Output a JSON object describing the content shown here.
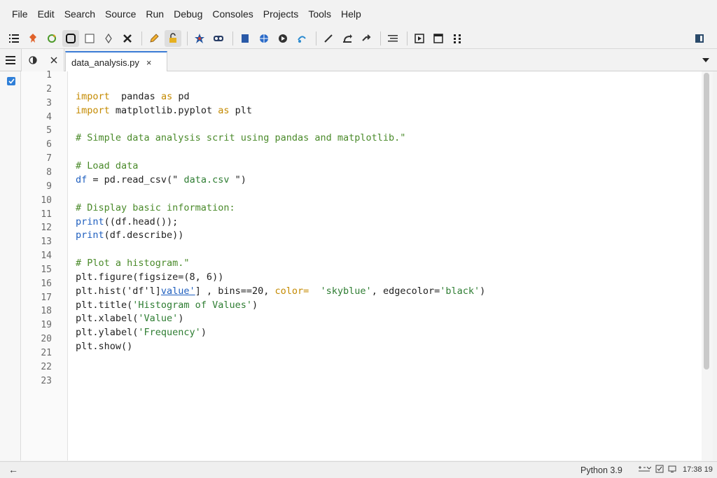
{
  "menu": [
    "File",
    "Edit",
    "Search",
    "Source",
    "Run",
    "Debug",
    "Consoles",
    "Projects",
    "Tools",
    "Help"
  ],
  "toolbar": {
    "icons": [
      "list-icon",
      "pin-icon",
      "refresh-icon",
      "save-icon",
      "square-icon",
      "pointer-icon",
      "debug-icon",
      "edit-icon",
      "unlock-icon",
      "star-icon",
      "bug-icon",
      "save-all-icon",
      "globe-icon",
      "run-icon",
      "step-icon",
      "line-icon",
      "return-icon",
      "jump-icon",
      "indent-icon",
      "maximize-icon",
      "window-icon",
      "grid-icon"
    ],
    "right_icon": "panel-icon"
  },
  "tabs": {
    "active_file": "data_analysis.py",
    "close_glyph": "×"
  },
  "editor": {
    "line_numbers": [
      "1",
      "2",
      "3",
      "4",
      "5",
      "6",
      "7",
      "8",
      "9",
      "10",
      "11",
      "12",
      "13",
      "14",
      "15",
      "16",
      "17",
      "18",
      "19",
      "20",
      "21",
      "22",
      "23"
    ],
    "lines": [
      {
        "n": "2",
        "parts": [
          [
            "kw",
            "import"
          ],
          [
            "",
            "  pandas "
          ],
          [
            "kw",
            "as"
          ],
          [
            "",
            " pd"
          ]
        ]
      },
      {
        "n": "3",
        "parts": [
          [
            "kw",
            "import"
          ],
          [
            "",
            " matplotlib.pyplot "
          ],
          [
            "kw",
            "as"
          ],
          [
            "",
            " plt"
          ]
        ]
      },
      {
        "n": "5",
        "parts": [
          [
            "cm",
            "# Simple data analysis scrit using pandas and matplotlib.\""
          ]
        ]
      },
      {
        "n": "7",
        "parts": [
          [
            "cm",
            "# Load data"
          ]
        ]
      },
      {
        "n": "8",
        "parts": [
          [
            "fn",
            "df"
          ],
          [
            "",
            " = pd.read_csv(\""
          ],
          [
            "st",
            " data.csv "
          ],
          [
            "",
            "\")"
          ]
        ]
      },
      {
        "n": "10",
        "parts": [
          [
            "cm",
            "# Display basic information:"
          ]
        ]
      },
      {
        "n": "11",
        "parts": [
          [
            "fn",
            "print"
          ],
          [
            "",
            "((df.head());"
          ]
        ]
      },
      {
        "n": "12",
        "parts": [
          [
            "fn",
            "print"
          ],
          [
            "",
            "(df.describe))"
          ]
        ]
      },
      {
        "n": "14",
        "parts": [
          [
            "cm",
            "# Plot a histogram.\""
          ]
        ]
      },
      {
        "n": "15",
        "parts": [
          [
            "",
            "plt.figure(figsize=(8, 6))"
          ]
        ]
      },
      {
        "n": "16",
        "parts": [
          [
            "",
            "plt.hist('df'l]"
          ],
          [
            "lnk",
            "value'"
          ],
          [
            "",
            "] , bins==20, "
          ],
          [
            "kw",
            "color="
          ],
          [
            "st",
            "  'skyblue'"
          ],
          [
            "",
            ", edgecolor="
          ],
          [
            "st",
            "'black'"
          ],
          [
            "",
            ")"
          ]
        ]
      },
      {
        "n": "17",
        "parts": [
          [
            "",
            "plt.title("
          ],
          [
            "st",
            "'Histogram of Values'"
          ],
          [
            "",
            ")"
          ]
        ]
      },
      {
        "n": "18",
        "parts": [
          [
            "",
            "plt.xlabel("
          ],
          [
            "st",
            "'Value'"
          ],
          [
            "",
            ")"
          ]
        ]
      },
      {
        "n": "19",
        "parts": [
          [
            "",
            "plt.ylabel("
          ],
          [
            "st",
            "'Frequency'"
          ],
          [
            "",
            ")"
          ]
        ]
      },
      {
        "n": "20",
        "parts": [
          [
            "",
            "plt.show()"
          ]
        ]
      }
    ]
  },
  "status": {
    "back": "←",
    "python_version": "Python 3.9",
    "time": "17:38 19"
  },
  "colors": {
    "accent": "#3a7bd5",
    "keyword": "#c48a00",
    "comment": "#4a8a2a",
    "function": "#1f5fbf"
  }
}
